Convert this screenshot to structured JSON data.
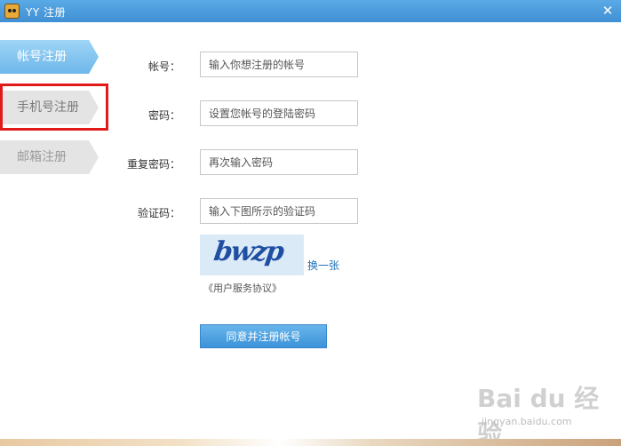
{
  "window": {
    "title": "YY 注册",
    "close_glyph": "✕"
  },
  "sidebar": {
    "tabs": [
      {
        "label": "帐号注册",
        "active": true
      },
      {
        "label": "手机号注册",
        "active": false
      },
      {
        "label": "邮箱注册",
        "active": false
      }
    ]
  },
  "form": {
    "account": {
      "label": "帐号：",
      "placeholder": "输入你想注册的帐号"
    },
    "password": {
      "label": "密码：",
      "placeholder": "设置您帐号的登陆密码"
    },
    "confirm": {
      "label": "重复密码：",
      "placeholder": "再次输入密码"
    },
    "captcha": {
      "label": "验证码：",
      "placeholder": "输入下图所示的验证码",
      "image_text": "bwzp",
      "refresh_label": "换一张"
    },
    "agreement_label": "《用户服务协议》",
    "submit_label": "同意并注册帐号"
  },
  "watermark": {
    "logo": "Bai du 经验",
    "url": "jingyan.baidu.com"
  },
  "colors": {
    "titlebar": "#4a9ddd",
    "accent": "#6db7ea",
    "highlight": "#e11a1a",
    "link": "#1f6fb8"
  }
}
